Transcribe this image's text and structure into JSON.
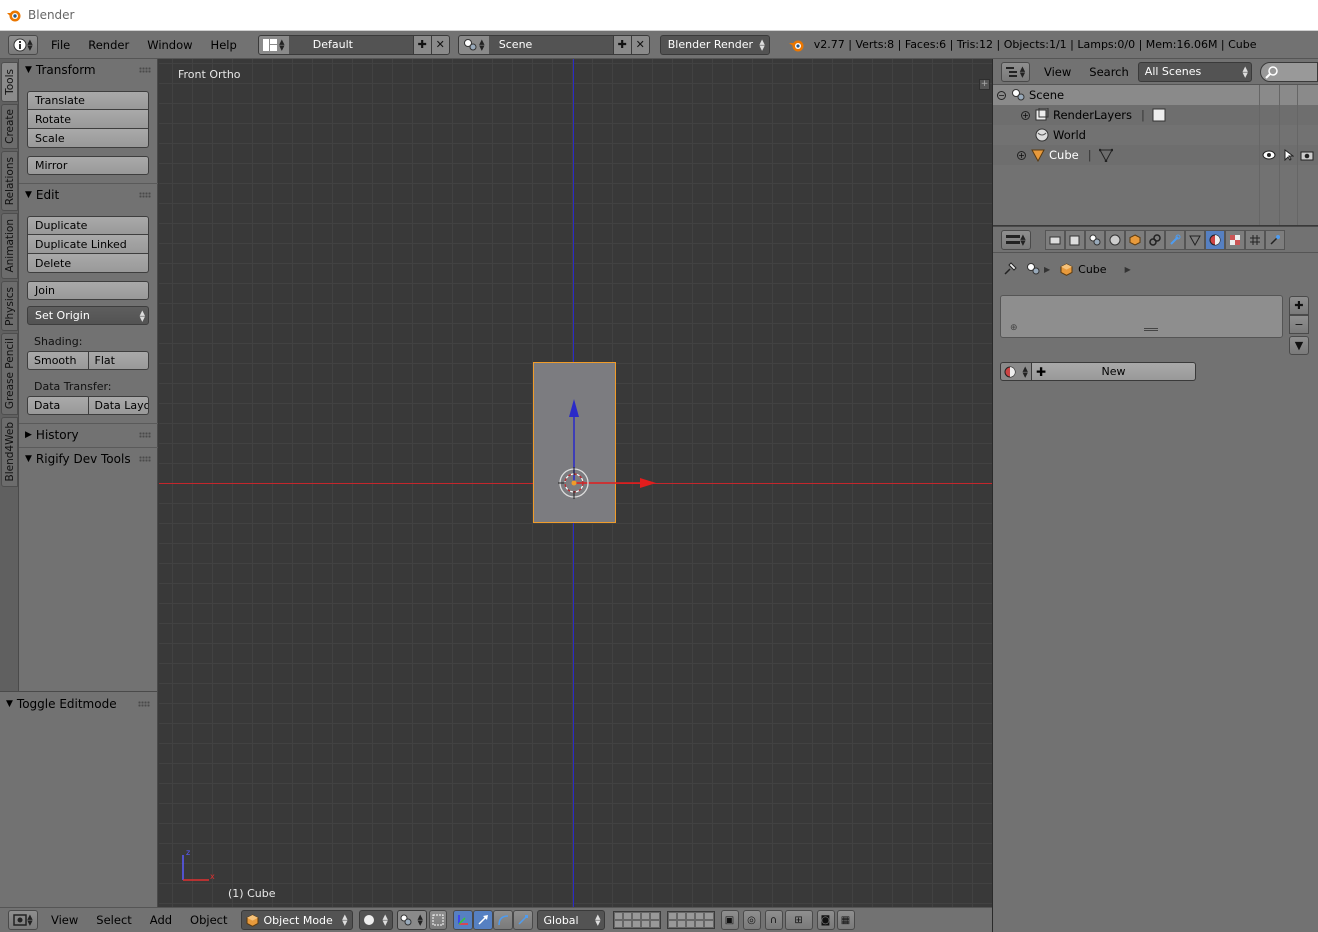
{
  "window": {
    "title": "Blender"
  },
  "info": {
    "menus": [
      "File",
      "Render",
      "Window",
      "Help"
    ],
    "layout": "Default",
    "scene": "Scene",
    "engine": "Blender Render",
    "stats": "v2.77 | Verts:8 | Faces:6 | Tris:12 | Objects:1/1 | Lamps:0/0 | Mem:16.06M | Cube"
  },
  "tabs": [
    "Tools",
    "Create",
    "Relations",
    "Animation",
    "Physics",
    "Grease Pencil",
    "Blend4Web"
  ],
  "toolshelf": {
    "transform": {
      "title": "Transform",
      "buttons": [
        "Translate",
        "Rotate",
        "Scale"
      ],
      "mirror": "Mirror"
    },
    "edit": {
      "title": "Edit",
      "buttons": [
        "Duplicate",
        "Duplicate Linked",
        "Delete"
      ],
      "join": "Join",
      "set_origin": "Set Origin",
      "shading_label": "Shading:",
      "shading": [
        "Smooth",
        "Flat"
      ],
      "transfer_label": "Data Transfer:",
      "transfer": [
        "Data",
        "Data Layo"
      ]
    },
    "history": "History",
    "rigify": "Rigify Dev Tools"
  },
  "operator": {
    "title": "Toggle Editmode"
  },
  "viewport": {
    "view_name": "Front Ortho",
    "object_label": "(1) Cube"
  },
  "view3d_header": {
    "menus": [
      "View",
      "Select",
      "Add",
      "Object"
    ],
    "mode": "Object Mode",
    "orientation": "Global"
  },
  "outliner": {
    "menus": [
      "View",
      "Search"
    ],
    "filter": "All Scenes",
    "items": [
      "Scene",
      "RenderLayers",
      "World",
      "Cube"
    ]
  },
  "properties": {
    "breadcrumb": "Cube",
    "new_button": "New"
  },
  "colors": {
    "selection_orange": "#f09c2a",
    "x_axis": "#c4262c",
    "z_axis": "#2a2ac8",
    "active_tab": "#5680c2"
  }
}
